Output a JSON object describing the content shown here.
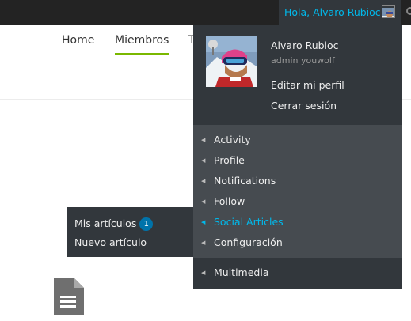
{
  "admin_bar": {
    "greeting": "Hola, Alvaro Rubioc"
  },
  "site_nav": {
    "items": [
      {
        "label": "Home",
        "active": false
      },
      {
        "label": "Miembros",
        "active": true
      },
      {
        "label": "T",
        "active": false
      }
    ]
  },
  "account_menu": {
    "display_name": "Alvaro Rubioc",
    "username": "admin youwolf",
    "edit_profile": "Editar mi perfil",
    "logout": "Cerrar sesión",
    "items": [
      {
        "label": "Activity"
      },
      {
        "label": "Profile"
      },
      {
        "label": "Notifications"
      },
      {
        "label": "Follow"
      },
      {
        "label": "Social Articles",
        "current": true
      },
      {
        "label": "Configuración"
      }
    ],
    "multimedia": "Multimedia"
  },
  "social_articles_submenu": {
    "my_articles": "Mis artículos",
    "my_articles_count": "1",
    "new_article": "Nuevo artículo"
  },
  "colors": {
    "admin_bar_bg": "#232323",
    "dropdown_bg": "#32373c",
    "menu_group_bg": "#464b50",
    "link_highlight": "#00b9eb",
    "badge_bg": "#0073aa",
    "nav_active_underline": "#7ab800"
  }
}
